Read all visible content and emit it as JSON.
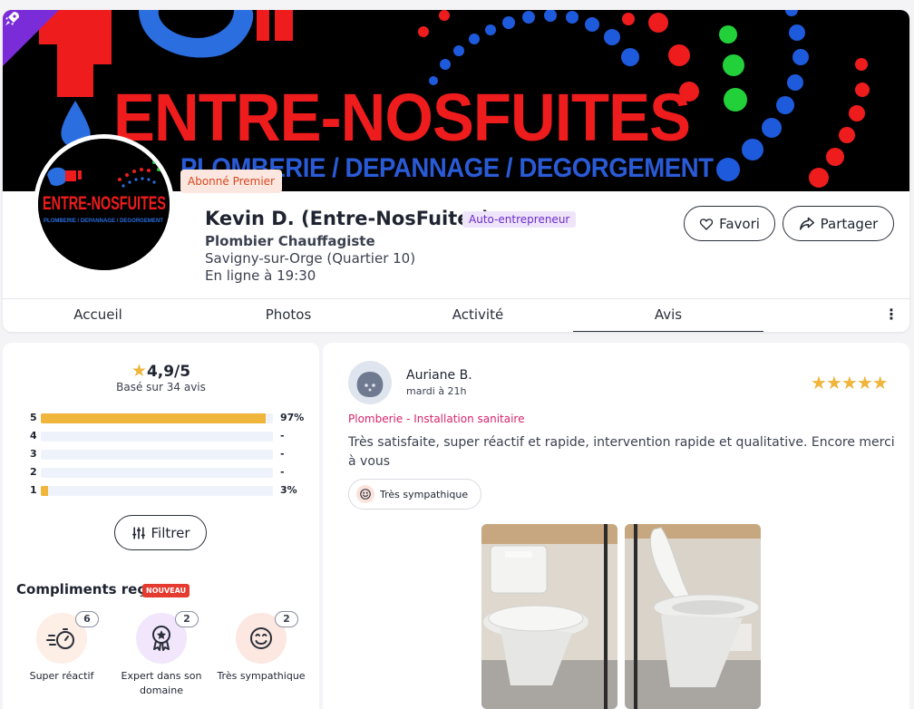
{
  "banner": {
    "title": "ENTRE-NOSFUITES",
    "subtitle": "PLOMBERIE / DEPANNAGE / DEGORGEMENT"
  },
  "avatar_logo": {
    "title": "ENTRE-NOSFUITES",
    "subtitle": "PLOMBERIE / DEPANNAGE / DEGORGEMENT"
  },
  "profile": {
    "premium_badge": "Abonné Premier",
    "name": "Kevin D. (Entre-NosFuites)",
    "status_badge": "Auto-entrepreneur",
    "job": "Plombier Chauffagiste",
    "location": "Savigny-sur-Orge (Quartier 10)",
    "online": "En ligne à 19:30"
  },
  "actions": {
    "favori": "Favori",
    "share": "Partager"
  },
  "tabs": [
    {
      "label": "Accueil",
      "active": false
    },
    {
      "label": "Photos",
      "active": false
    },
    {
      "label": "Activité",
      "active": false
    },
    {
      "label": "Avis",
      "active": true
    }
  ],
  "tabs_more": "⋮",
  "rating": {
    "score": "4,9/5",
    "count": "Basé sur 34 avis",
    "distribution": [
      {
        "label": "5",
        "percent": 97,
        "value": "97%"
      },
      {
        "label": "4",
        "percent": 0,
        "value": "-"
      },
      {
        "label": "3",
        "percent": 0,
        "value": "-"
      },
      {
        "label": "2",
        "percent": 0,
        "value": "-"
      },
      {
        "label": "1",
        "percent": 3,
        "value": "3%"
      }
    ],
    "filter": "Filtrer"
  },
  "compliments": {
    "title": "Compliments reçus",
    "badge": "NOUVEAU",
    "items": [
      {
        "label": "Super réactif",
        "count": "6",
        "icon": "stopwatch-icon",
        "bg": "#fdeee6"
      },
      {
        "label": "Expert dans son domaine",
        "count": "2",
        "icon": "medal-icon",
        "bg": "#f1e6fb"
      },
      {
        "label": "Très sympathique",
        "count": "2",
        "icon": "smiley-icon",
        "bg": "#fce7e1"
      }
    ]
  },
  "review": {
    "name": "Auriane B.",
    "date": "mardi à 21h",
    "stars": 5,
    "category": "Plomberie - Installation sanitaire",
    "text": "Très satisfaite, super réactif et rapide, intervention rapide et qualitative. Encore merci à vous",
    "chip": "Très sympathique"
  },
  "colors": {
    "accent": "#f0b53b",
    "category": "#d6246e",
    "premium": "#d9451e",
    "status": "#6d2cc9",
    "rocket": "#7a2cd8"
  }
}
